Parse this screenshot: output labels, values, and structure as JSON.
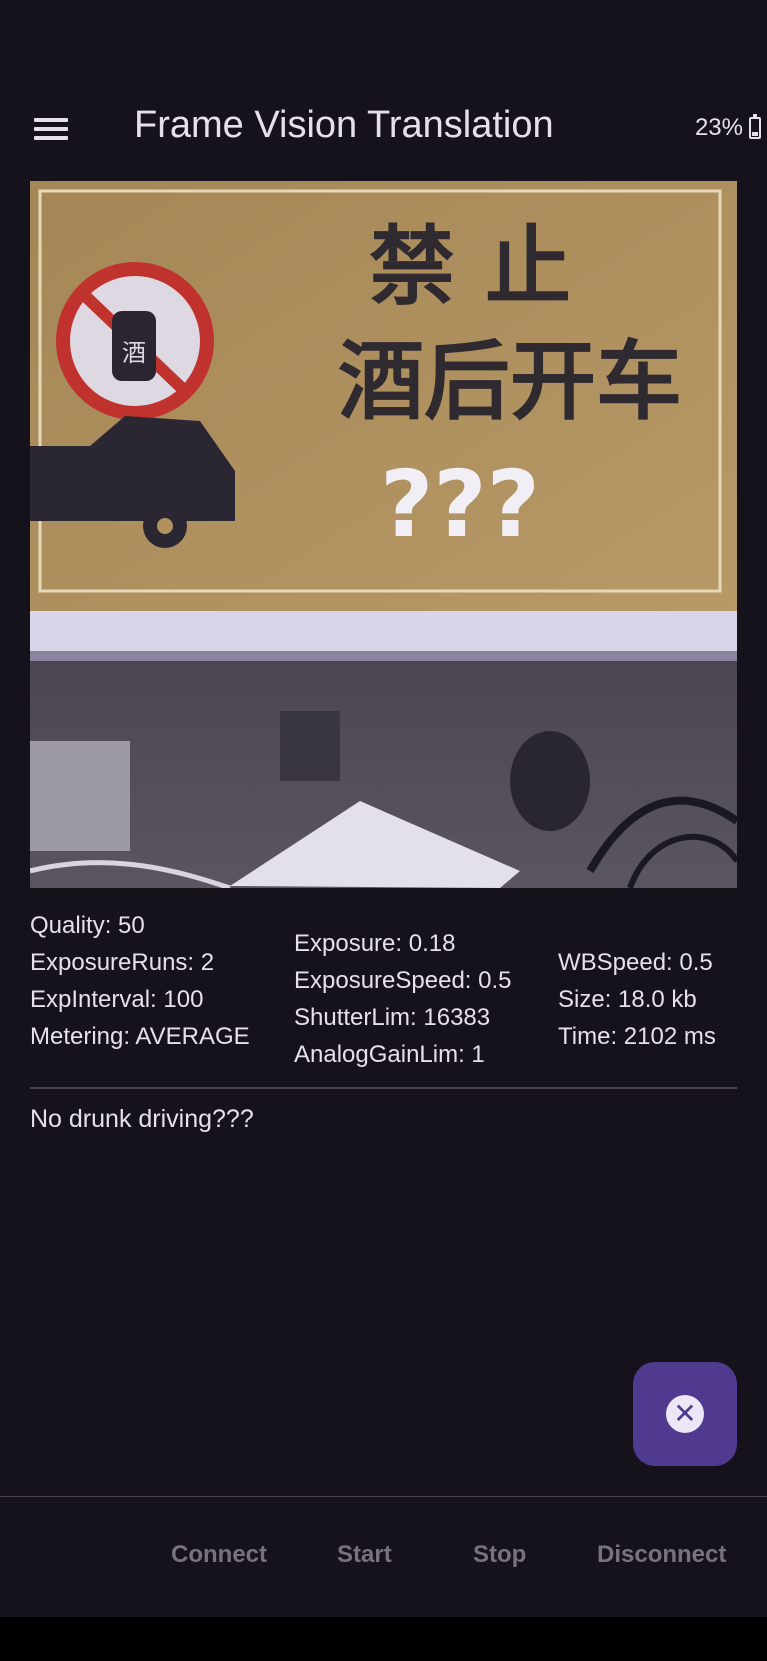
{
  "app_bar": {
    "title": "Frame Vision Translation",
    "battery_text": "23%",
    "battery_level": 0.23
  },
  "photo": {
    "sign_line1": "禁  止",
    "sign_line2": "酒后开车",
    "sign_marks": "???",
    "badge_char": "酒"
  },
  "stats": {
    "col1": [
      "Quality: 50",
      "ExposureRuns: 2",
      "ExpInterval: 100",
      "Metering: AVERAGE"
    ],
    "col2": [
      "Exposure: 0.18",
      "ExposureSpeed: 0.5",
      "ShutterLim: 16383",
      "AnalogGainLim: 1"
    ],
    "col3": [
      "WBSpeed: 0.5",
      "Size: 18.0 kb",
      "Time: 2102 ms"
    ]
  },
  "result_text": "No drunk driving???",
  "fab": {
    "icon": "close-icon",
    "glyph": "✕"
  },
  "bottom_bar": {
    "connect": "Connect",
    "start": "Start",
    "stop": "Stop",
    "disconnect": "Disconnect"
  },
  "colors": {
    "background": "#15121b",
    "fab": "#4f3a8f",
    "button_disabled": "#78727f",
    "sign_background": "#b3915f"
  }
}
